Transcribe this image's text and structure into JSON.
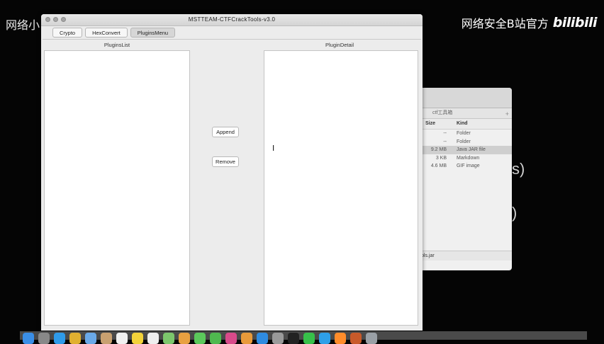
{
  "watermarks": {
    "left": "网络小白站",
    "right": "网络安全B站官方",
    "right_logo": "bilibili"
  },
  "app": {
    "title": "MSTTEAM-CTFCrackTools-v3.0",
    "tabs": [
      {
        "label": "Crypto",
        "active": false
      },
      {
        "label": "HexConvert",
        "active": false
      },
      {
        "label": "PluginsMenu",
        "active": true
      }
    ],
    "plugins_list_label": "PluginsList",
    "plugin_detail_label": "PluginDetail",
    "append_label": "Append",
    "remove_label": "Remove"
  },
  "finder": {
    "path": "ctf工具箱",
    "columns": {
      "size": "Size",
      "kind": "Kind"
    },
    "rows": [
      {
        "size": "--",
        "kind": "Folder",
        "selected": false
      },
      {
        "size": "--",
        "kind": "Folder",
        "selected": false
      },
      {
        "size": "9.2 MB",
        "kind": "Java JAR file",
        "selected": true
      },
      {
        "size": "3 KB",
        "kind": "Markdown",
        "selected": false
      },
      {
        "size": "4.6 MB",
        "kind": "GIF image",
        "selected": false
      }
    ],
    "filename": "ols.jar"
  },
  "background_text": {
    "line1": "s)",
    "line2": ")"
  },
  "dock": {
    "icons": [
      "finder-icon",
      "launchpad-icon",
      "safari-icon",
      "chrome-icon",
      "mail-icon",
      "contacts-icon",
      "calendar-icon",
      "notes-icon",
      "reminders-icon",
      "maps-icon",
      "photos-icon",
      "messages-icon",
      "facetime-icon",
      "itunes-icon",
      "ibooks-icon",
      "appstore-icon",
      "preferences-icon",
      "terminal-icon",
      "wechat-icon",
      "qq-icon",
      "sublime-icon",
      "java-icon",
      "trash-icon"
    ],
    "colors": [
      "#3a8ee6",
      "#888888",
      "#2f9be9",
      "#e0b030",
      "#6aa9e8",
      "#c8a070",
      "#f0f0f0",
      "#f2d23a",
      "#eeeeee",
      "#7cc66c",
      "#e8a040",
      "#5bc85b",
      "#4fb84f",
      "#d84a8a",
      "#e89a3a",
      "#2e8be0",
      "#9a9a9a",
      "#222222",
      "#37c04a",
      "#2ea0e8",
      "#ff8c2a",
      "#c85a2a",
      "#9aa0a6"
    ]
  }
}
